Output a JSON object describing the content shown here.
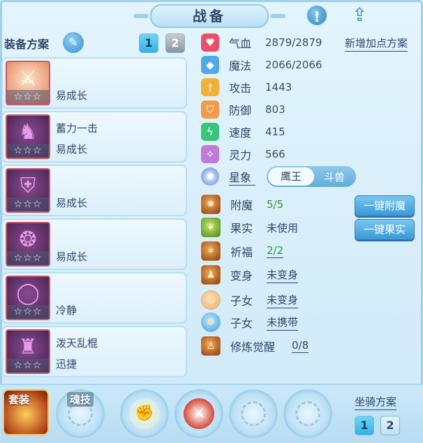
{
  "header": {
    "title": "战备",
    "alert_icon": "alert-icon",
    "share_icon": "share-icon"
  },
  "plan": {
    "label": "装备方案",
    "tabs": [
      "1",
      "2"
    ],
    "active": "1"
  },
  "equipment": [
    {
      "icon": "weapon-icon",
      "name": "",
      "trait": "易成长",
      "stars": "☆☆☆"
    },
    {
      "icon": "helmet-icon",
      "name": "蓄力一击",
      "trait": "易成长",
      "stars": "☆☆☆"
    },
    {
      "icon": "armor-icon",
      "name": "",
      "trait": "易成长",
      "stars": "☆☆☆"
    },
    {
      "icon": "necklace-icon",
      "name": "",
      "trait": "易成长",
      "stars": "☆☆☆"
    },
    {
      "icon": "belt-icon",
      "name": "",
      "trait": "冷静",
      "stars": "☆☆☆"
    },
    {
      "icon": "boots-icon",
      "name": "泼天乱棍",
      "trait": "迅捷",
      "stars": "☆☆☆"
    }
  ],
  "stats": {
    "add_plan": "新增加点方案",
    "hp": {
      "label": "气血",
      "value": "2879/2879"
    },
    "mp": {
      "label": "魔法",
      "value": "2066/2066"
    },
    "atk": {
      "label": "攻击",
      "value": "1443"
    },
    "def": {
      "label": "防御",
      "value": "803"
    },
    "spd": {
      "label": "速度",
      "value": "415"
    },
    "spi": {
      "label": "灵力",
      "value": "566"
    },
    "star": {
      "label": "星象",
      "options": [
        "鹰王",
        "斗兽"
      ],
      "active": "鹰王"
    }
  },
  "features": {
    "enchant": {
      "label": "附魔",
      "value": "5/5"
    },
    "fruit": {
      "label": "果实",
      "value": "未使用"
    },
    "blessing": {
      "label": "祈福",
      "value": "2/2"
    },
    "transform": {
      "label": "变身",
      "value": "未变身"
    },
    "child1": {
      "label": "子女",
      "value": "未变身"
    },
    "child2": {
      "label": "子女",
      "value": "未携带"
    },
    "cultivate": {
      "label": "修炼觉醒",
      "value": "0/8"
    },
    "btn_enchant": "一键附魔",
    "btn_fruit": "一键果实"
  },
  "bottom": {
    "suit_label": "套装",
    "soul_label": "魂技",
    "mount_label": "坐骑方案",
    "mount_tabs": [
      "1",
      "2"
    ],
    "mount_active": "1"
  },
  "colors": {
    "accent": "#2fb1e6",
    "green_value": "#2f9a2f",
    "frame": "#9fd0ec"
  }
}
